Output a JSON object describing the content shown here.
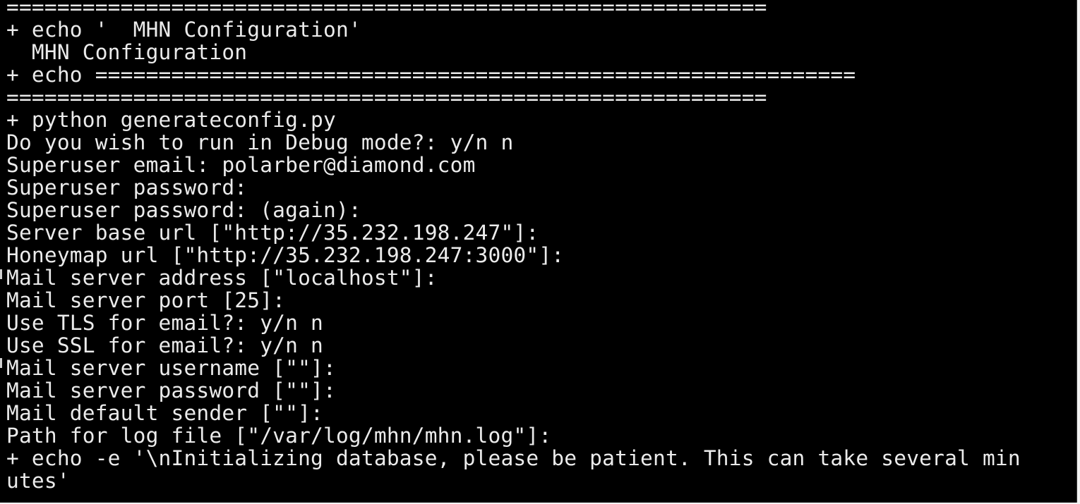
{
  "terminal": {
    "lines": [
      "============================================================",
      "+ echo '  MHN Configuration'",
      "  MHN Configuration",
      "+ echo ============================================================",
      "============================================================",
      "+ python generateconfig.py",
      "Do you wish to run in Debug mode?: y/n n",
      "Superuser email: polarber@diamond.com",
      "Superuser password:",
      "Superuser password: (again):",
      "Server base url [\"http://35.232.198.247\"]:",
      "Honeymap url [\"http://35.232.198.247:3000\"]:",
      "Mail server address [\"localhost\"]:",
      "Mail server port [25]:",
      "Use TLS for email?: y/n n",
      "Use SSL for email?: y/n n",
      "Mail server username [\"\"]:",
      "Mail server password [\"\"]:",
      "Mail default sender [\"\"]:",
      "Path for log file [\"/var/log/mhn/mhn.log\"]:",
      "+ echo -e '\\nInitializing database, please be patient. This can take several min",
      "utes'"
    ]
  },
  "colors": {
    "background": "#000000",
    "foreground": "#ebebeb"
  }
}
